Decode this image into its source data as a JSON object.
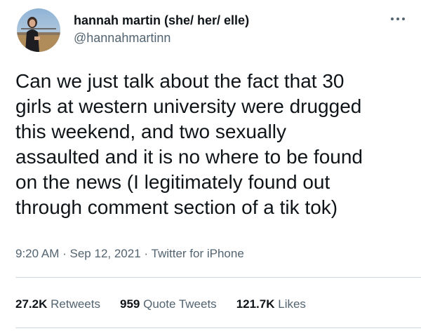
{
  "author": {
    "display_name": "hannah martin (she/ her/ elle)",
    "handle": "@hannahmartinn"
  },
  "icons": {
    "more": "more-horizontal-icon"
  },
  "tweet": {
    "text": "Can we just talk about the fact that 30\ngirls at western university were drugged\nthis weekend, and two sexually\nassaulted and it is no where to be found\non the news (I legitimately found out\nthrough comment section of a tik tok)"
  },
  "meta": {
    "time": "9:20 AM",
    "separator": "·",
    "date": "Sep 12, 2021",
    "source": "Twitter for iPhone"
  },
  "stats": {
    "retweets": {
      "count": "27.2K",
      "label": "Retweets"
    },
    "quotes": {
      "count": "959",
      "label": "Quote Tweets"
    },
    "likes": {
      "count": "121.7K",
      "label": "Likes"
    }
  },
  "colors": {
    "primary_text": "#0f1419",
    "secondary_text": "#536471",
    "divider": "#cfd9de"
  }
}
